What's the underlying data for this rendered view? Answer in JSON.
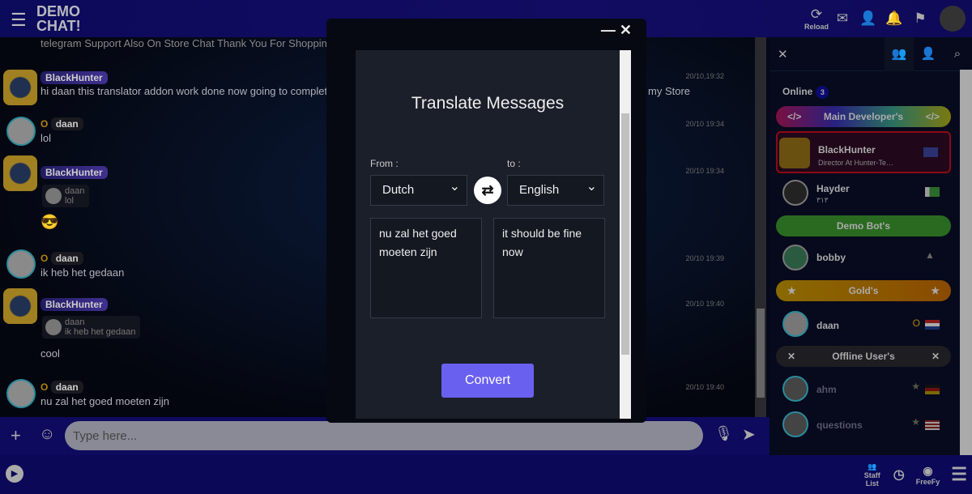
{
  "header": {
    "logo_line1": "DEMO",
    "logo_line2": "CHAT!",
    "reload_label": "Reload"
  },
  "messages": [
    {
      "user": "",
      "text": "telegram Support Also On Store Chat Thank You For Shopping Hun",
      "time": ""
    },
    {
      "user": "BlackHunter",
      "text": "hi daan this translator addon work done now going to complete",
      "text_tail": "my Store",
      "time": "20/10,19:32"
    },
    {
      "user": "daan",
      "rank": "O",
      "text": "lol",
      "time": "20/10 19:34"
    },
    {
      "user": "BlackHunter",
      "quote_user": "daan",
      "quote_text": "lol",
      "text": "😎",
      "time": "20/10 19:34"
    },
    {
      "user": "daan",
      "rank": "O",
      "text": "ik heb het gedaan",
      "time": "20/10 19:39"
    },
    {
      "user": "BlackHunter",
      "quote_user": "daan",
      "quote_text": "ik heb het gedaan",
      "text": "cool",
      "time": "20/10 19:40"
    },
    {
      "user": "daan",
      "rank": "O",
      "text": "nu zal het goed moeten zijn",
      "time": "20/10 19:40"
    }
  ],
  "input": {
    "placeholder": "Type here..."
  },
  "footer": {
    "staff_label": "Staff List",
    "freefy_label": "FreeFy"
  },
  "panel": {
    "online_label": "Online",
    "online_count": "3",
    "groups": [
      {
        "label": "Main Developer's",
        "icon": "code",
        "color": "#7a1040"
      },
      {
        "label": "Demo Bot's",
        "color": "#2a6a20"
      },
      {
        "label": "Gold's",
        "icon": "star",
        "color": "#8a6000"
      },
      {
        "label": "Offline User's",
        "icon": "x",
        "color": "#1e1e22"
      }
    ],
    "users": [
      {
        "name": "BlackHunter",
        "sub": "Director At Hunter-Te…",
        "flag": "UK"
      },
      {
        "name": "Hayder",
        "sub": "٣١٣",
        "flag": "PK"
      },
      {
        "name": "bobby"
      },
      {
        "name": "daan",
        "rank": "O",
        "flag": "NL"
      },
      {
        "name": "ahm",
        "flag": "DE"
      },
      {
        "name": "questions",
        "flag": "US"
      }
    ]
  },
  "modal": {
    "title": "Translate Messages",
    "from_label": "From :",
    "to_label": "to :",
    "from_value": "Dutch",
    "to_value": "English",
    "source_text": "nu zal het goed moeten zijn",
    "result_text": "it should be fine now",
    "convert_label": "Convert"
  }
}
